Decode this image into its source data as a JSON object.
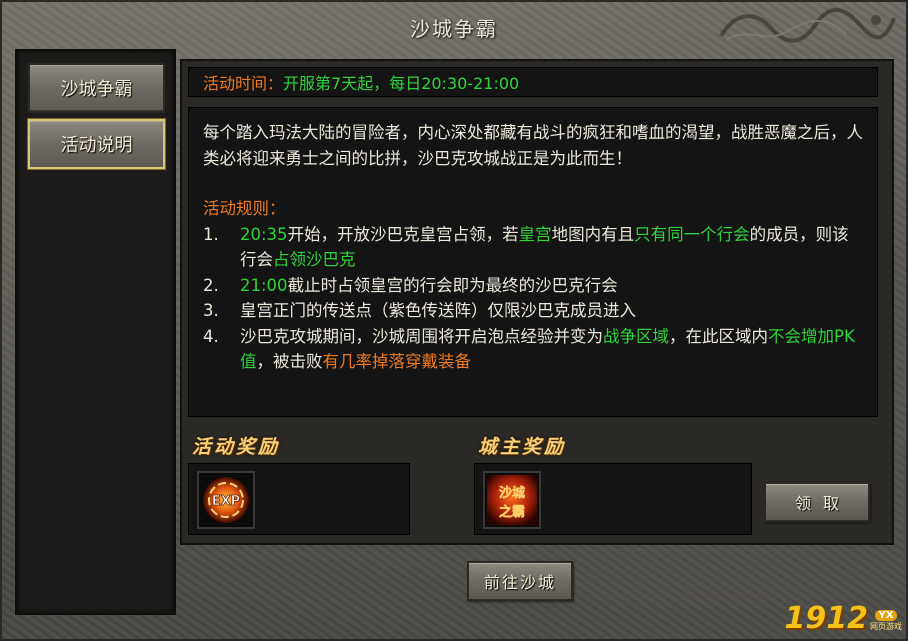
{
  "window": {
    "title": "沙城争霸"
  },
  "sidebar": {
    "items": [
      {
        "label": "沙城争霸",
        "active": false
      },
      {
        "label": "活动说明",
        "active": true
      }
    ]
  },
  "activity_time": {
    "label": "活动时间：",
    "value": "开服第7天起，每日20:30-21:00"
  },
  "description": {
    "intro": "每个踏入玛法大陆的冒险者，内心深处都藏有战斗的疯狂和嗜血的渴望，战胜恶魔之后，人类必将迎来勇士之间的比拼，沙巴克攻城战正是为此而生！",
    "rules_title": "活动规则：",
    "rules": [
      {
        "num": "1.",
        "parts": [
          {
            "text": "20:35",
            "color": "green"
          },
          {
            "text": "开始，开放沙巴克皇宫占领，若",
            "color": "white"
          },
          {
            "text": "皇宫",
            "color": "green"
          },
          {
            "text": "地图内有且",
            "color": "white"
          },
          {
            "text": "只有同一个行会",
            "color": "green"
          },
          {
            "text": "的成员，则该行会",
            "color": "white"
          },
          {
            "text": "占领沙巴克",
            "color": "green"
          }
        ]
      },
      {
        "num": "2.",
        "parts": [
          {
            "text": "21:00",
            "color": "green"
          },
          {
            "text": "截止时占领皇宫的行会即为最终的沙巴克行会",
            "color": "white"
          }
        ]
      },
      {
        "num": "3.",
        "parts": [
          {
            "text": "皇宫正门的传送点（紫色传送阵）仅限沙巴克成员进入",
            "color": "white"
          }
        ]
      },
      {
        "num": "4.",
        "parts": [
          {
            "text": "沙巴克攻城期间，沙城周围将开启泡点经验并变为",
            "color": "white"
          },
          {
            "text": "战争区域",
            "color": "green"
          },
          {
            "text": "，在此区域内",
            "color": "white"
          },
          {
            "text": "不会增加PK值",
            "color": "green"
          },
          {
            "text": "，被击败",
            "color": "white"
          },
          {
            "text": "有几率掉落穿戴装备",
            "color": "orange"
          }
        ]
      }
    ]
  },
  "rewards": {
    "activity_title": "活动奖励",
    "activity_item": {
      "icon": "exp-orb-icon",
      "label": "EXP"
    },
    "lord_title": "城主奖励",
    "lord_item": {
      "icon": "castle-lord-title-icon",
      "line1": "沙城",
      "line2": "之霸"
    },
    "claim_label": "领取"
  },
  "footer": {
    "goto_label": "前往沙城"
  },
  "watermark": {
    "number": "1912",
    "badge": "YX",
    "sub": "网页游戏"
  },
  "colors": {
    "green": "#2fd33a",
    "orange": "#f07a1e",
    "white": "#ece8dc",
    "gold": "#f3d07a"
  }
}
